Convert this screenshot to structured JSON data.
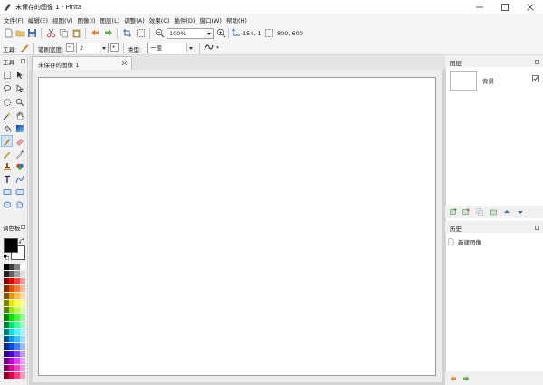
{
  "window": {
    "title": "未保存的图像 1 - Pinta",
    "icons": [
      "app-icon",
      "minimize-icon",
      "maximize-icon",
      "close-icon"
    ]
  },
  "menu": [
    {
      "label": "文件(F)"
    },
    {
      "label": "编辑(E)"
    },
    {
      "label": "视图(V)"
    },
    {
      "label": "图像(I)"
    },
    {
      "label": "图层(L)"
    },
    {
      "label": "调整(A)"
    },
    {
      "label": "效果(C)"
    },
    {
      "label": "插件(D)"
    },
    {
      "label": "窗口(W)"
    },
    {
      "label": "帮助(H)"
    }
  ],
  "toolbar": {
    "zoom_value": "100%",
    "cursor_position": "154, 1",
    "selection_size": "800, 600"
  },
  "tool_options": {
    "tool_label": "工具:",
    "brush_width_label": "笔刷宽度:",
    "brush_width_value": "2",
    "type_label": "类型:",
    "type_value": "一般"
  },
  "tools_panel": {
    "title": "工具",
    "tools": [
      "rectangle-select",
      "move-selected",
      "lasso-select",
      "move-selection",
      "ellipse-select",
      "zoom",
      "magic-wand",
      "pan",
      "paint-bucket",
      "gradient",
      "paintbrush",
      "eraser",
      "pencil",
      "color-picker",
      "clone-stamp",
      "recolor",
      "text",
      "line-curve",
      "rectangle",
      "rounded-rectangle",
      "ellipse",
      "freeform-shape"
    ],
    "active_tool": "paintbrush"
  },
  "palette": {
    "title": "调色板",
    "primary_color": "#000000",
    "secondary_color": "#ffffff"
  },
  "document": {
    "tab_label": "未保存的图像 1",
    "canvas_color": "#ffffff"
  },
  "layers_panel": {
    "title": "图层",
    "layers": [
      {
        "name": "背景",
        "visible": true
      }
    ]
  },
  "history_panel": {
    "title": "历史",
    "items": [
      {
        "label": "新建图像"
      }
    ]
  }
}
